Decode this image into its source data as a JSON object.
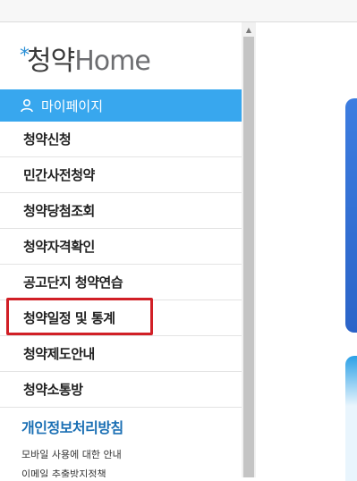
{
  "logo": {
    "mark": "*",
    "korean": "청약",
    "latin": "Home"
  },
  "mypage": {
    "label": "마이페이지"
  },
  "menu": {
    "items": [
      {
        "label": "청약신청"
      },
      {
        "label": "민간사전청약"
      },
      {
        "label": "청약당첨조회"
      },
      {
        "label": "청약자격확인"
      },
      {
        "label": "공고단지 청약연습"
      },
      {
        "label": "청약일정 및 통계"
      },
      {
        "label": "청약제도안내"
      },
      {
        "label": "청약소통방"
      }
    ]
  },
  "footer": {
    "privacy": "개인정보처리방침",
    "links": [
      "모바일 사용에 대한 안내",
      "이메일 추출방지정책"
    ]
  },
  "colors": {
    "mypage_bg": "#38a7ee",
    "highlight_border": "#d11f26",
    "privacy_link": "#1a6fb4"
  }
}
